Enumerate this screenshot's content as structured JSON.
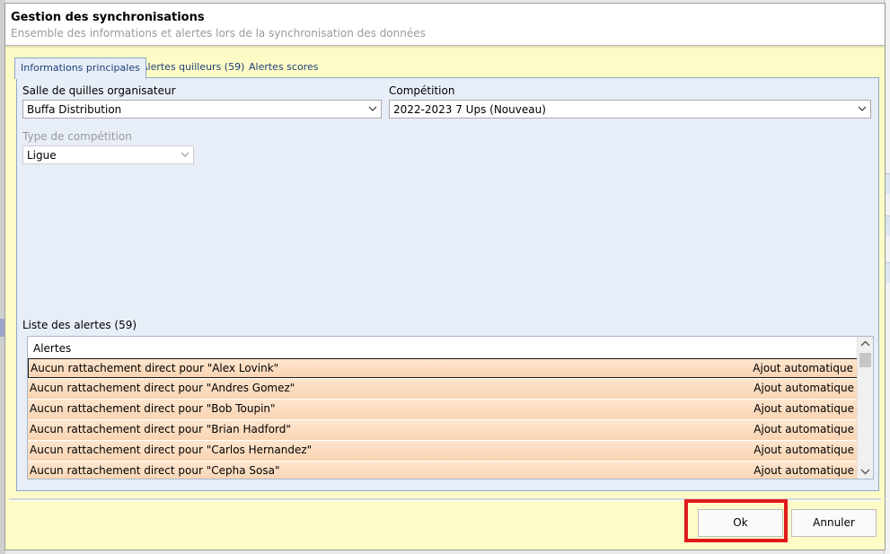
{
  "dialog": {
    "title": "Gestion des synchronisations",
    "subtitle": "Ensemble des informations et alertes lors de la synchronisation des données"
  },
  "tabs": [
    {
      "label": "Informations principales",
      "active": true
    },
    {
      "label": "Alertes quilleurs (59)",
      "active": false
    },
    {
      "label": "Alertes scores",
      "active": false
    }
  ],
  "form": {
    "host_label": "Salle de quilles organisateur",
    "host_value": "Buffa Distribution",
    "competition_label": "Compétition",
    "competition_value": "2022-2023 7 Ups (Nouveau)",
    "type_label": "Type de compétition",
    "type_value": "Ligue"
  },
  "alerts": {
    "section_label": "Liste des alertes (59)",
    "column_header": "Alertes",
    "rows": [
      {
        "message": "Aucun rattachement direct pour \"Alex Lovink\"",
        "action": "Ajout automatique"
      },
      {
        "message": "Aucun rattachement direct pour \"Andres Gomez\"",
        "action": "Ajout automatique"
      },
      {
        "message": "Aucun rattachement direct pour \"Bob Toupin\"",
        "action": "Ajout automatique"
      },
      {
        "message": "Aucun rattachement direct pour \"Brian Hadford\"",
        "action": "Ajout automatique"
      },
      {
        "message": "Aucun rattachement direct pour \"Carlos Hernandez\"",
        "action": "Ajout automatique"
      },
      {
        "message": "Aucun rattachement direct pour \"Cepha Sosa\"",
        "action": "Ajout automatique"
      }
    ]
  },
  "buttons": {
    "ok_label": "Ok",
    "cancel_label": "Annuler"
  },
  "colors": {
    "dialog_bg": "#fdfbc6",
    "panel_bg": "#e7eef8",
    "row_bg": "#fde2c6",
    "highlight": "#e01a1a",
    "tab_text": "#1e3f78"
  }
}
